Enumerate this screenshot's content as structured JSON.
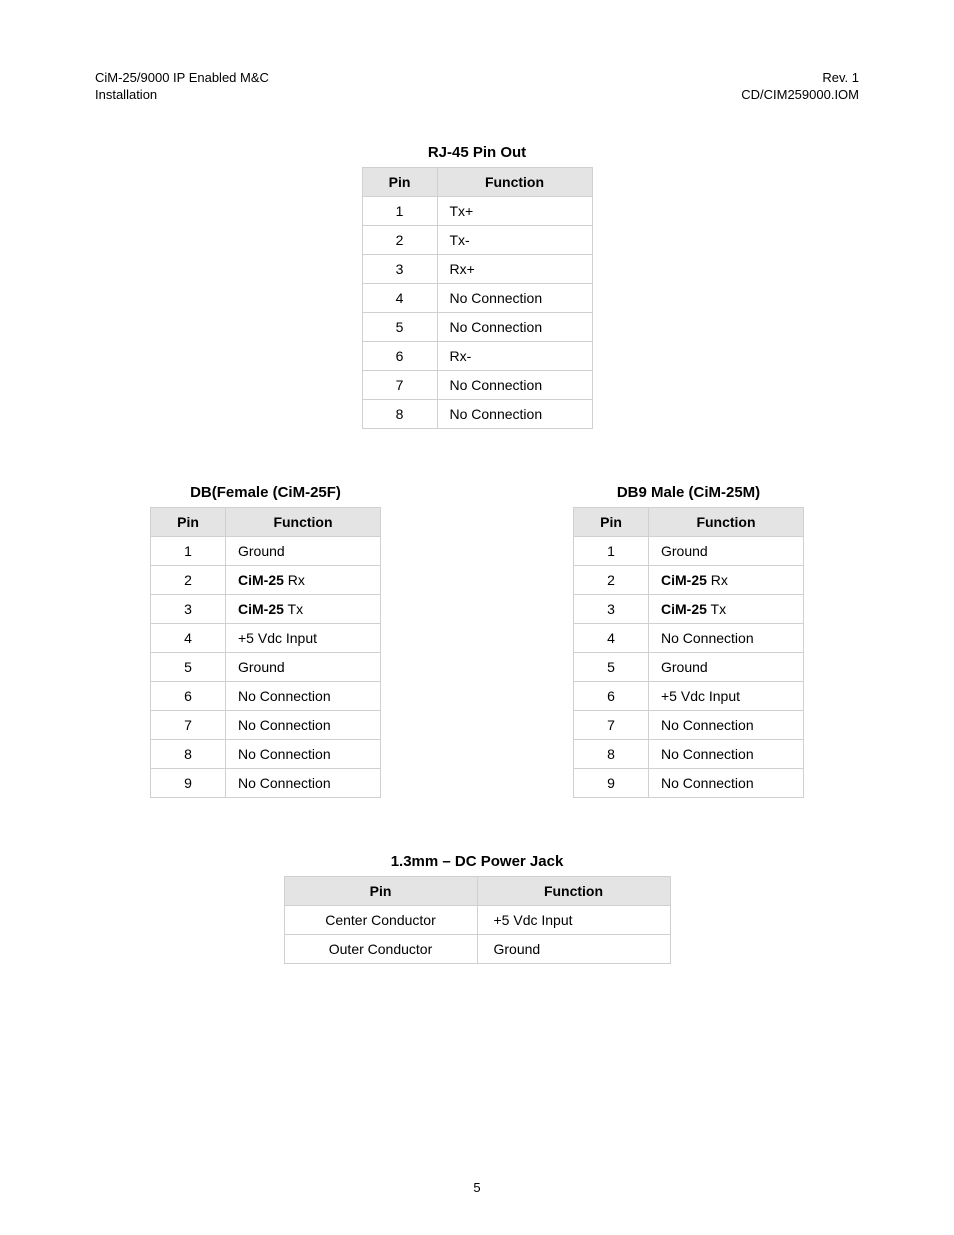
{
  "header": {
    "left_line1": "CiM-25/9000 IP Enabled M&C",
    "left_line2": "Installation",
    "right_line1": "Rev. 1",
    "right_line2": "CD/CIM259000.IOM"
  },
  "rj45": {
    "title": "RJ-45 Pin Out",
    "col_pin": "Pin",
    "col_func": "Function",
    "rows": [
      {
        "pin": "1",
        "func": "Tx+"
      },
      {
        "pin": "2",
        "func": "Tx-"
      },
      {
        "pin": "3",
        "func": "Rx+"
      },
      {
        "pin": "4",
        "func": "No Connection"
      },
      {
        "pin": "5",
        "func": "No Connection"
      },
      {
        "pin": "6",
        "func": "Rx-"
      },
      {
        "pin": "7",
        "func": "No Connection"
      },
      {
        "pin": "8",
        "func": "No Connection"
      }
    ]
  },
  "db9f": {
    "title": "DB(Female (CiM-25F)",
    "col_pin": "Pin",
    "col_func": "Function",
    "rows": [
      {
        "pin": "1",
        "func": "Ground",
        "bold_prefix": ""
      },
      {
        "pin": "2",
        "func": " Rx",
        "bold_prefix": "CiM-25"
      },
      {
        "pin": "3",
        "func": " Tx",
        "bold_prefix": "CiM-25"
      },
      {
        "pin": "4",
        "func": "+5 Vdc Input",
        "bold_prefix": ""
      },
      {
        "pin": "5",
        "func": "Ground",
        "bold_prefix": ""
      },
      {
        "pin": "6",
        "func": "No Connection",
        "bold_prefix": ""
      },
      {
        "pin": "7",
        "func": "No Connection",
        "bold_prefix": ""
      },
      {
        "pin": "8",
        "func": "No Connection",
        "bold_prefix": ""
      },
      {
        "pin": "9",
        "func": "No Connection",
        "bold_prefix": ""
      }
    ]
  },
  "db9m": {
    "title": "DB9 Male (CiM-25M)",
    "col_pin": "Pin",
    "col_func": "Function",
    "rows": [
      {
        "pin": "1",
        "func": "Ground",
        "bold_prefix": ""
      },
      {
        "pin": "2",
        "func": " Rx",
        "bold_prefix": "CiM-25"
      },
      {
        "pin": "3",
        "func": " Tx",
        "bold_prefix": "CiM-25"
      },
      {
        "pin": "4",
        "func": "No Connection",
        "bold_prefix": ""
      },
      {
        "pin": "5",
        "func": "Ground",
        "bold_prefix": ""
      },
      {
        "pin": "6",
        "func": "+5 Vdc Input",
        "bold_prefix": ""
      },
      {
        "pin": "7",
        "func": "No Connection",
        "bold_prefix": ""
      },
      {
        "pin": "8",
        "func": "No Connection",
        "bold_prefix": ""
      },
      {
        "pin": "9",
        "func": "No Connection",
        "bold_prefix": ""
      }
    ]
  },
  "dcjack": {
    "title": "1.3mm – DC Power Jack",
    "col_pin": "Pin",
    "col_func": "Function",
    "rows": [
      {
        "pin": "Center Conductor",
        "func": "+5 Vdc Input"
      },
      {
        "pin": "Outer Conductor",
        "func": "Ground"
      }
    ]
  },
  "page_number": "5"
}
